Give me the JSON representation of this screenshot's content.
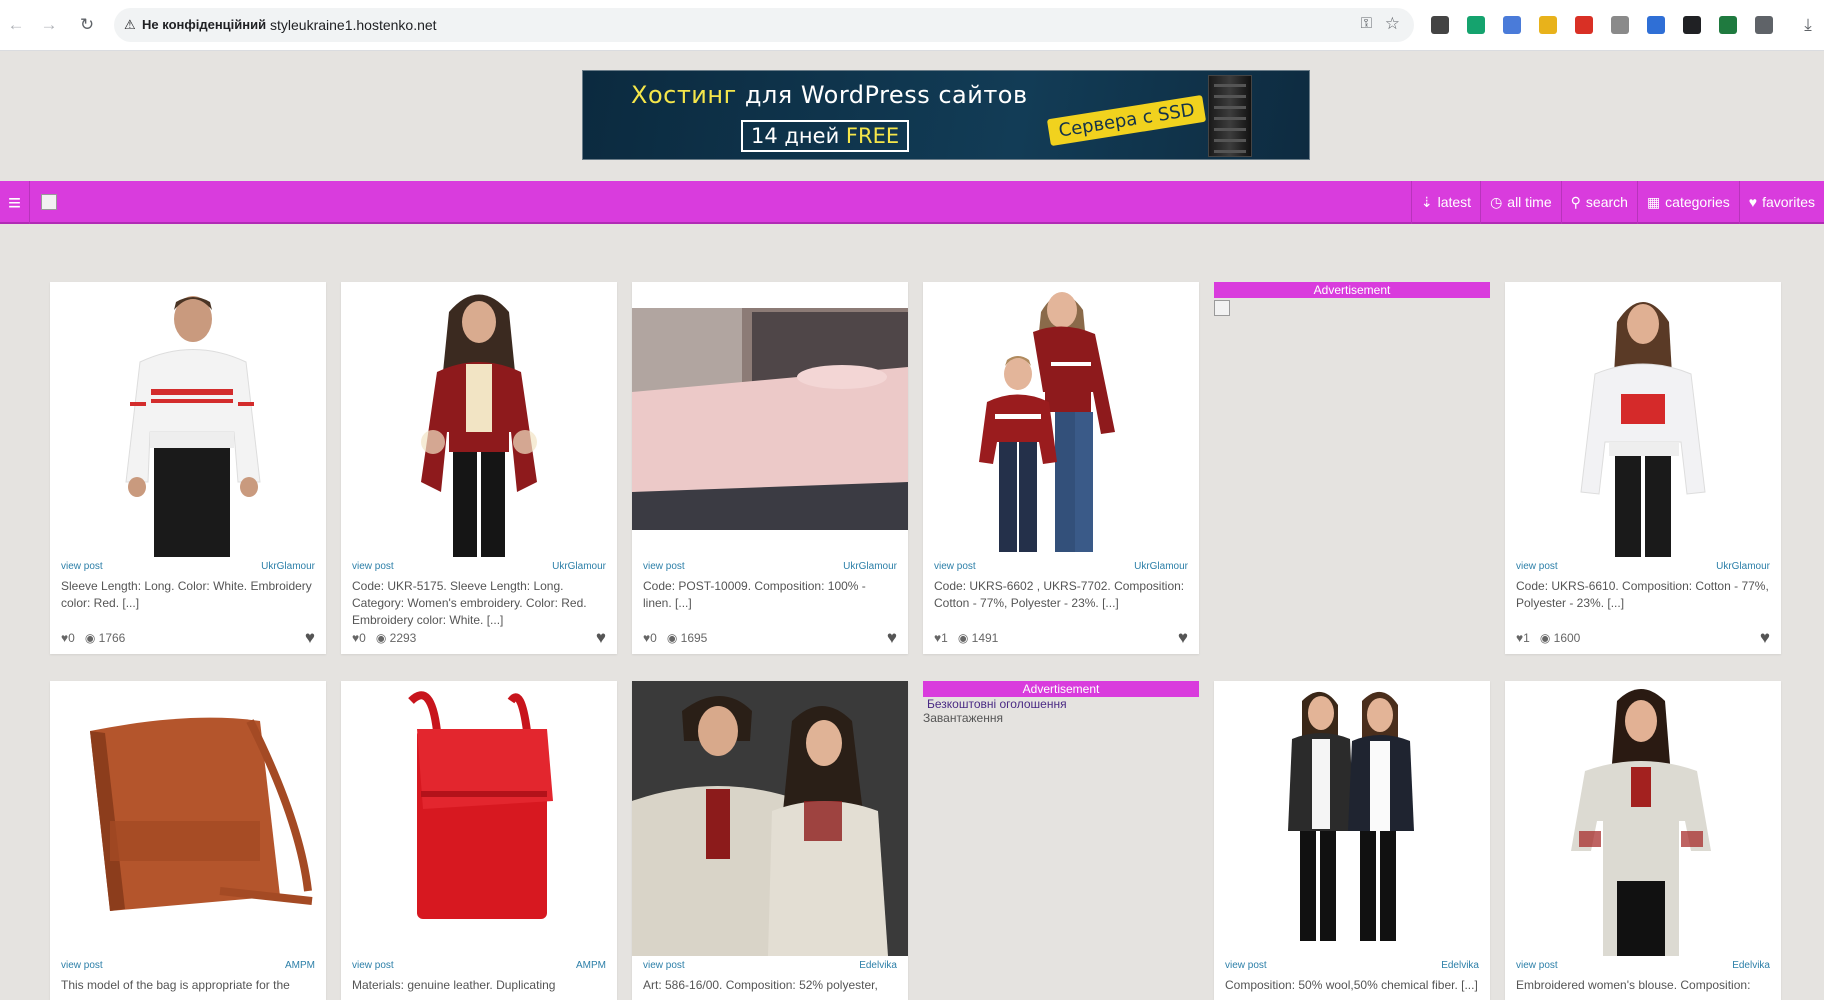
{
  "browser": {
    "security_label": "Не конфіденційний",
    "url": "styleukraine1.hostenko.net",
    "extensions": [
      {
        "icon": "pen-icon",
        "color": "#444444"
      },
      {
        "icon": "grammarly-icon",
        "color": "#15a36e"
      },
      {
        "icon": "translate-icon",
        "color": "#4a7bd9"
      },
      {
        "icon": "bookmark-ext-icon",
        "color": "#e8b21b"
      },
      {
        "icon": "record-icon",
        "color": "#d93025"
      },
      {
        "icon": "image-ext-icon",
        "color": "#8a8a8a"
      },
      {
        "icon": "circle-ext-icon",
        "color": "#2f6fd6"
      },
      {
        "icon": "camera-ext-icon",
        "color": "#202124"
      },
      {
        "icon": "excel-ext-icon",
        "color": "#1f7a3f"
      },
      {
        "icon": "puzzle-icon",
        "color": "#5f6368"
      }
    ]
  },
  "banner": {
    "line1_a": "Хостинг",
    "line1_b": "для WordPress сайтов",
    "line2_a": "14 дней",
    "line2_b": "FREE",
    "badge": "Сервера с SSD"
  },
  "nav": {
    "items": [
      {
        "label": "latest",
        "icon": "sort-icon",
        "glyph": "⇣"
      },
      {
        "label": "all time",
        "icon": "clock-icon",
        "glyph": "◷"
      },
      {
        "label": "search",
        "icon": "search-icon",
        "glyph": "⚲"
      },
      {
        "label": "categories",
        "icon": "grid-icon",
        "glyph": "▦"
      },
      {
        "label": "favorites",
        "icon": "heart-icon",
        "glyph": "♥"
      }
    ]
  },
  "cards": [
    {
      "view": "view post",
      "shop": "UkrGlamour",
      "desc": "Sleeve Length: Long. Color: White. Embroidery color: Red. [...]",
      "likes": "0",
      "views": "1766"
    },
    {
      "view": "view post",
      "shop": "UkrGlamour",
      "desc": "Code: UKR-5175. Sleeve Length: Long. Category: Women's embroidery. Color: Red. Embroidery color: White. [...]",
      "likes": "0",
      "views": "2293"
    },
    {
      "view": "view post",
      "shop": "UkrGlamour",
      "desc": "Code: POST-10009. Composition: 100% - linen. [...]",
      "likes": "0",
      "views": "1695"
    },
    {
      "view": "view post",
      "shop": "UkrGlamour",
      "desc": "Code: UKRS-6602 , UKRS-7702. Composition: Cotton - 77%, Polyester - 23%. [...]",
      "likes": "1",
      "views": "1491"
    },
    {
      "view": "view post",
      "shop": "UkrGlamour",
      "desc": "Code: UKRS-6610. Composition: Cotton - 77%, Polyester - 23%. [...]",
      "likes": "1",
      "views": "1600"
    },
    {
      "view": "view post",
      "shop": "AMPM",
      "desc": "This model of the bag is appropriate for the"
    },
    {
      "view": "view post",
      "shop": "AMPM",
      "desc": "Materials: genuine leather. Duplicating"
    },
    {
      "view": "view post",
      "shop": "Edelvika",
      "desc": "Art: 586-16/00. Composition: 52% polyester,"
    },
    {
      "view": "view post",
      "shop": "Edelvika",
      "desc": "Composition: 50% wool,50% chemical fiber. [...]"
    },
    {
      "view": "view post",
      "shop": "Edelvika",
      "desc": "Embroidered women's blouse. Composition:"
    }
  ],
  "ads": {
    "label": "Advertisement",
    "free_ads": "Безкоштовні оголошення",
    "loading": "Завантаження"
  },
  "colors": {
    "accent": "#d93cdd",
    "link": "#2c7fa8"
  }
}
